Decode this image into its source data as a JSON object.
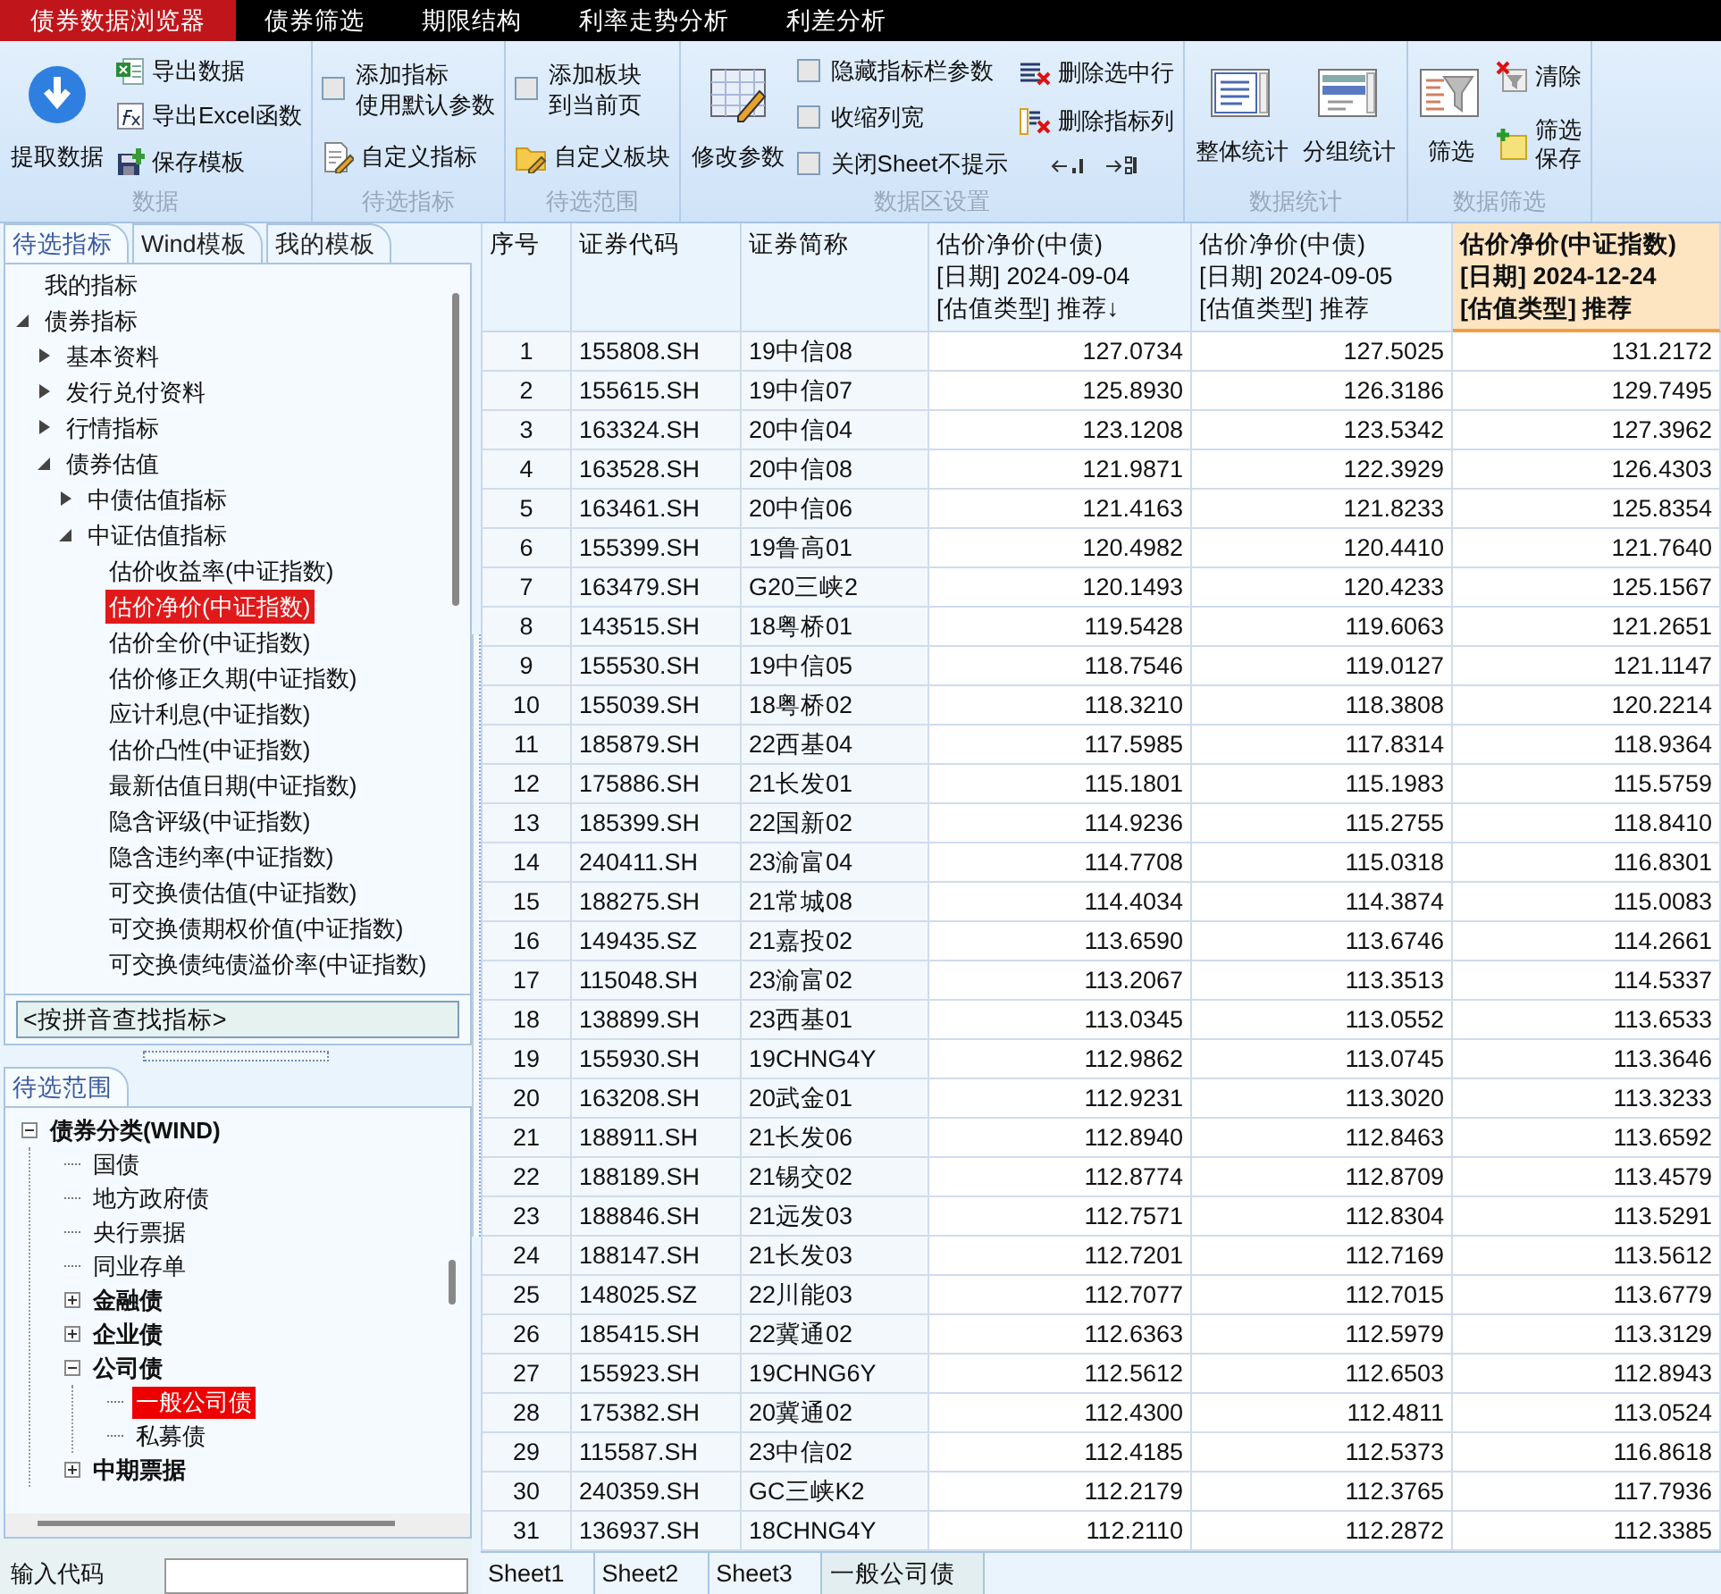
{
  "menu_tabs": [
    {
      "label": "债券数据浏览器",
      "selected": true
    },
    {
      "label": "债券筛选",
      "selected": false
    },
    {
      "label": "期限结构",
      "selected": false
    },
    {
      "label": "利率走势分析",
      "selected": false
    },
    {
      "label": "利差分析",
      "selected": false
    }
  ],
  "ribbon": {
    "groups": [
      {
        "title": "数据",
        "columns": [
          [
            {
              "kind": "big",
              "label": "提取数据"
            }
          ],
          [
            {
              "kind": "small",
              "lines": [
                "导出数据"
              ]
            },
            {
              "kind": "small",
              "lines": [
                "导出Excel函数"
              ]
            },
            {
              "kind": "small",
              "lines": [
                "保存模板"
              ]
            }
          ]
        ]
      },
      {
        "title": "待选指标",
        "columns": [
          [
            {
              "kind": "check",
              "lines": [
                "添加指标",
                "使用默认参数"
              ],
              "checked": false
            },
            {
              "kind": "small",
              "lines": [
                "自定义指标"
              ]
            }
          ]
        ]
      },
      {
        "title": "待选范围",
        "columns": [
          [
            {
              "kind": "check",
              "lines": [
                "添加板块",
                "到当前页"
              ],
              "checked": false
            },
            {
              "kind": "small",
              "lines": [
                "自定义板块"
              ]
            }
          ]
        ]
      },
      {
        "title": "数据区设置",
        "columns": [
          [
            {
              "kind": "big",
              "label": "修改参数"
            }
          ],
          [
            {
              "kind": "check",
              "lines": [
                "隐藏指标栏参数"
              ],
              "checked": false
            },
            {
              "kind": "check",
              "lines": [
                "收缩列宽"
              ],
              "checked": false
            },
            {
              "kind": "check",
              "lines": [
                "关闭Sheet不提示"
              ],
              "checked": false
            }
          ],
          [
            {
              "kind": "small",
              "lines": [
                "删除选中行"
              ]
            },
            {
              "kind": "small",
              "lines": [
                "删除指标列"
              ]
            },
            {
              "kind": "arrows"
            }
          ]
        ]
      },
      {
        "title": "数据统计",
        "columns": [
          [
            {
              "kind": "big",
              "label": "整体统计"
            }
          ],
          [
            {
              "kind": "big",
              "label": "分组统计"
            }
          ]
        ]
      },
      {
        "title": "数据筛选",
        "columns": [
          [
            {
              "kind": "big",
              "label": "筛选"
            }
          ],
          [
            {
              "kind": "small",
              "lines": [
                "清除"
              ]
            },
            {
              "kind": "small",
              "lines": [
                "筛选",
                "保存"
              ]
            }
          ]
        ]
      }
    ]
  },
  "indicator_panel": {
    "tabs": [
      {
        "label": "待选指标",
        "selected": true
      },
      {
        "label": "Wind模板",
        "selected": false
      },
      {
        "label": "我的模板",
        "selected": false
      }
    ],
    "tree": [
      {
        "label": "我的指标",
        "selected": false
      },
      {
        "label": "债券指标",
        "expanded": true,
        "selected": false,
        "children": [
          {
            "label": "基本资料",
            "expanded": false,
            "selected": false
          },
          {
            "label": "发行兑付资料",
            "expanded": false,
            "selected": false
          },
          {
            "label": "行情指标",
            "expanded": false,
            "selected": false
          },
          {
            "label": "债券估值",
            "expanded": true,
            "selected": false,
            "children": [
              {
                "label": "中债估值指标",
                "expanded": false,
                "selected": false
              },
              {
                "label": "中证估值指标",
                "expanded": true,
                "selected": false,
                "children": [
                  {
                    "label": "估价收益率(中证指数)",
                    "selected": false
                  },
                  {
                    "label": "估价净价(中证指数)",
                    "selected": true
                  },
                  {
                    "label": "估价全价(中证指数)",
                    "selected": false
                  },
                  {
                    "label": "估价修正久期(中证指数)",
                    "selected": false
                  },
                  {
                    "label": "应计利息(中证指数)",
                    "selected": false
                  },
                  {
                    "label": "估价凸性(中证指数)",
                    "selected": false
                  },
                  {
                    "label": "最新估值日期(中证指数)",
                    "selected": false
                  },
                  {
                    "label": "隐含评级(中证指数)",
                    "selected": false
                  },
                  {
                    "label": "隐含违约率(中证指数)",
                    "selected": false
                  },
                  {
                    "label": "可交换债估值(中证指数)",
                    "selected": false
                  },
                  {
                    "label": "可交换债期权价值(中证指数)",
                    "selected": false
                  },
                  {
                    "label": "可交换债纯债溢价率(中证指数)",
                    "selected": false
                  }
                ]
              }
            ]
          }
        ]
      }
    ],
    "search": {
      "placeholder": "<按拼音查找指标>"
    }
  },
  "range_panel": {
    "tabs": [
      {
        "label": "待选范围",
        "selected": true
      }
    ],
    "tree": [
      {
        "label": "债券分类(WIND)",
        "expanded": true,
        "selected": false,
        "children": [
          {
            "label": "国债",
            "selected": false
          },
          {
            "label": "地方政府债",
            "selected": false
          },
          {
            "label": "央行票据",
            "selected": false
          },
          {
            "label": "同业存单",
            "selected": false
          },
          {
            "label": "金融债",
            "expanded": false,
            "selected": false
          },
          {
            "label": "企业债",
            "expanded": false,
            "selected": false
          },
          {
            "label": "公司债",
            "expanded": true,
            "selected": false,
            "children": [
              {
                "label": "一般公司债",
                "selected": true
              },
              {
                "label": "私募债",
                "selected": false
              }
            ]
          },
          {
            "label": "中期票据",
            "expanded": false,
            "selected": false
          }
        ]
      }
    ]
  },
  "code_input": {
    "label": "输入代码"
  },
  "table": {
    "columns": [
      {
        "lines": [
          "序号"
        ],
        "selected": false
      },
      {
        "lines": [
          "证券代码"
        ],
        "selected": false
      },
      {
        "lines": [
          "证券简称"
        ],
        "selected": false
      },
      {
        "lines": [
          "估价净价(中债)",
          "[日期] 2024-09-04",
          "[估值类型] 推荐↓"
        ],
        "selected": false
      },
      {
        "lines": [
          "估价净价(中债)",
          "[日期] 2024-09-05",
          "[估值类型] 推荐"
        ],
        "selected": false
      },
      {
        "lines": [
          "估价净价(中证指数)",
          "[日期] 2024-12-24",
          "[估值类型] 推荐"
        ],
        "selected": true
      }
    ],
    "rows": [
      [
        "1",
        "155808.SH",
        "19中信08",
        "127.0734",
        "127.5025",
        "131.2172"
      ],
      [
        "2",
        "155615.SH",
        "19中信07",
        "125.8930",
        "126.3186",
        "129.7495"
      ],
      [
        "3",
        "163324.SH",
        "20中信04",
        "123.1208",
        "123.5342",
        "127.3962"
      ],
      [
        "4",
        "163528.SH",
        "20中信08",
        "121.9871",
        "122.3929",
        "126.4303"
      ],
      [
        "5",
        "163461.SH",
        "20中信06",
        "121.4163",
        "121.8233",
        "125.8354"
      ],
      [
        "6",
        "155399.SH",
        "19鲁高01",
        "120.4982",
        "120.4410",
        "121.7640"
      ],
      [
        "7",
        "163479.SH",
        "G20三峡2",
        "120.1493",
        "120.4233",
        "125.1567"
      ],
      [
        "8",
        "143515.SH",
        "18粤桥01",
        "119.5428",
        "119.6063",
        "121.2651"
      ],
      [
        "9",
        "155530.SH",
        "19中信05",
        "118.7546",
        "119.0127",
        "121.1147"
      ],
      [
        "10",
        "155039.SH",
        "18粤桥02",
        "118.3210",
        "118.3808",
        "120.2214"
      ],
      [
        "11",
        "185879.SH",
        "22西基04",
        "117.5985",
        "117.8314",
        "118.9364"
      ],
      [
        "12",
        "175886.SH",
        "21长发01",
        "115.1801",
        "115.1983",
        "115.5759"
      ],
      [
        "13",
        "185399.SH",
        "22国新02",
        "114.9236",
        "115.2755",
        "118.8410"
      ],
      [
        "14",
        "240411.SH",
        "23渝富04",
        "114.7708",
        "115.0318",
        "116.8301"
      ],
      [
        "15",
        "188275.SH",
        "21常城08",
        "114.4034",
        "114.3874",
        "115.0083"
      ],
      [
        "16",
        "149435.SZ",
        "21嘉投02",
        "113.6590",
        "113.6746",
        "114.2661"
      ],
      [
        "17",
        "115048.SH",
        "23渝富02",
        "113.2067",
        "113.3513",
        "114.5337"
      ],
      [
        "18",
        "138899.SH",
        "23西基01",
        "113.0345",
        "113.0552",
        "113.6533"
      ],
      [
        "19",
        "155930.SH",
        "19CHNG4Y",
        "112.9862",
        "113.0745",
        "113.3646"
      ],
      [
        "20",
        "163208.SH",
        "20武金01",
        "112.9231",
        "113.3020",
        "113.3233"
      ],
      [
        "21",
        "188911.SH",
        "21长发06",
        "112.8940",
        "112.8463",
        "113.6592"
      ],
      [
        "22",
        "188189.SH",
        "21锡交02",
        "112.8774",
        "112.8709",
        "113.4579"
      ],
      [
        "23",
        "188846.SH",
        "21远发03",
        "112.7571",
        "112.8304",
        "113.5291"
      ],
      [
        "24",
        "188147.SH",
        "21长发03",
        "112.7201",
        "112.7169",
        "113.5612"
      ],
      [
        "25",
        "148025.SZ",
        "22川能03",
        "112.7077",
        "112.7015",
        "113.6779"
      ],
      [
        "26",
        "185415.SH",
        "22冀通02",
        "112.6363",
        "112.5979",
        "113.3129"
      ],
      [
        "27",
        "155923.SH",
        "19CHNG6Y",
        "112.5612",
        "112.6503",
        "112.8943"
      ],
      [
        "28",
        "175382.SH",
        "20冀通02",
        "112.4300",
        "112.4811",
        "113.0524"
      ],
      [
        "29",
        "115587.SH",
        "23中信02",
        "112.4185",
        "112.5373",
        "116.8618"
      ],
      [
        "30",
        "240359.SH",
        "GC三峡K2",
        "112.2179",
        "112.3765",
        "117.7936"
      ],
      [
        "31",
        "136937.SH",
        "18CHNG4Y",
        "112.2110",
        "112.2872",
        "112.3385"
      ]
    ]
  },
  "sheet_tabs": [
    {
      "label": "Sheet1",
      "selected": false
    },
    {
      "label": "Sheet2",
      "selected": false
    },
    {
      "label": "Sheet3",
      "selected": false
    },
    {
      "label": "一般公司债",
      "selected": true
    }
  ]
}
